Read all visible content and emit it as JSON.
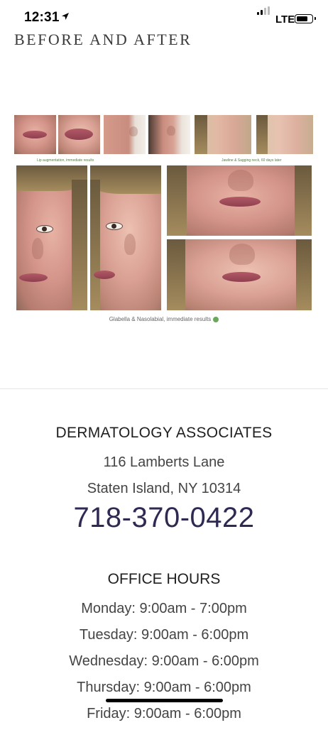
{
  "status_bar": {
    "time": "12:31",
    "network": "LTE"
  },
  "section": {
    "title": "BEFORE AND AFTER"
  },
  "gallery": {
    "caption_lips": "Lip augmentation, immediate results",
    "caption_jawline": "Jawline & Sagging neck, 60 days later",
    "main_caption": "Glabella & Nasolabial, immediate results"
  },
  "practice": {
    "name": "DERMATOLOGY ASSOCIATES",
    "address_line1": "116 Lamberts Lane",
    "address_line2": "Staten Island, NY 10314",
    "phone": "718-370-0422"
  },
  "office_hours": {
    "title": "OFFICE HOURS",
    "days": [
      "Monday: 9:00am - 7:00pm",
      "Tuesday: 9:00am - 6:00pm",
      "Wednesday: 9:00am - 6:00pm",
      "Thursday: 9:00am - 6:00pm",
      "Friday: 9:00am - 6:00pm"
    ]
  },
  "colors": {
    "phone": "#2f2a52",
    "check": "#6aa95a"
  }
}
